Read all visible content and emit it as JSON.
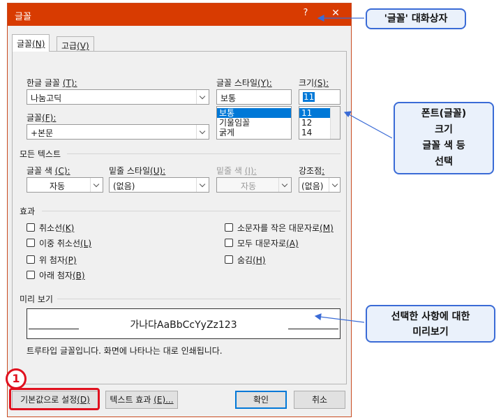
{
  "dialog": {
    "title": "글꼴",
    "help": "?",
    "close": "✕",
    "tabs": [
      {
        "label": "글꼴",
        "key": "(N)"
      },
      {
        "label": "고급",
        "key": "(V)"
      }
    ],
    "hangul_font": {
      "label": "한글 글꼴",
      "key": "(T):",
      "value": "나눔고딕"
    },
    "font": {
      "label": "글꼴",
      "key": "(F):",
      "value": "+본문"
    },
    "font_style": {
      "label": "글꼴 스타일",
      "key": "(Y):",
      "value": "보통",
      "options": [
        "보통",
        "기울임꼴",
        "굵게"
      ],
      "selected": 0
    },
    "size": {
      "label": "크기",
      "key": "(S):",
      "value": "11",
      "options": [
        "11",
        "12",
        "14"
      ],
      "selected": 0
    },
    "all_text_section": "모든 텍스트",
    "font_color": {
      "label": "글꼴 색",
      "key": "(C):",
      "value": "자동"
    },
    "underline_style": {
      "label": "밑줄 스타일",
      "key": "(U):",
      "value": "(없음)"
    },
    "underline_color": {
      "label": "밑줄 색",
      "key": "(I):",
      "value": "자동"
    },
    "emphasis": {
      "label": "강조점",
      "key": ":",
      "value": "(없음)"
    },
    "effects_section": "효과",
    "effects_left": [
      {
        "label": "취소선",
        "key": "(K)"
      },
      {
        "label": "이중 취소선",
        "key": "(L)"
      },
      {
        "label": "위 첨자",
        "key": "(P)"
      },
      {
        "label": "아래 첨자",
        "key": "(B)"
      }
    ],
    "effects_right": [
      {
        "label": "소문자를 작은 대문자로",
        "key": "(M)"
      },
      {
        "label": "모두 대문자로",
        "key": "(A)"
      },
      {
        "label": "숨김",
        "key": "(H)"
      }
    ],
    "preview_section": "미리 보기",
    "preview_text": "가나다AaBbCcYyZz123",
    "preview_note": "트루타입 글꼴입니다. 화면에 나타나는 대로 인쇄됩니다.",
    "buttons": {
      "default": {
        "label": "기본값으로 설정",
        "key": "(D)"
      },
      "text_effects": {
        "label": "텍스트 효과",
        "key": "(E)..."
      },
      "ok": "확인",
      "cancel": "취소"
    }
  },
  "annotations": {
    "marker_number": "1",
    "callout_title": "'글꼴' 대화상자",
    "callout_font": [
      "폰트(글꼴)",
      "크기",
      "글꼴 색 등",
      "선택"
    ],
    "callout_preview": [
      "선택한 사항에 대한",
      "미리보기"
    ]
  },
  "colors": {
    "titlebar": "#d83b01",
    "callout_border": "#3a6bd6",
    "marker": "#e0101e",
    "selection": "#0078d7"
  }
}
